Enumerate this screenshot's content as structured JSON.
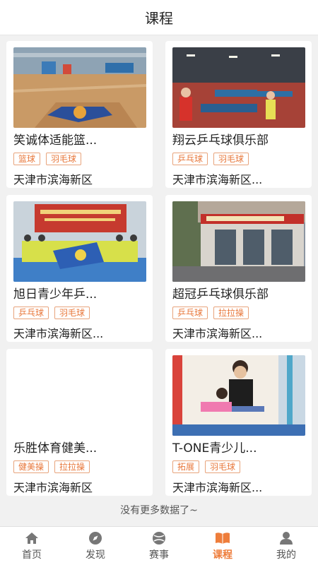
{
  "header": {
    "title": "课程"
  },
  "courses": [
    {
      "title": "笑诚体适能篮...",
      "tags": [
        "篮球",
        "羽毛球"
      ],
      "location": "天津市滨海新区"
    },
    {
      "title": "翔云乒乓球俱乐部",
      "tags": [
        "乒乓球",
        "羽毛球"
      ],
      "location": "天津市滨海新区..."
    },
    {
      "title": "旭日青少年乒...",
      "tags": [
        "乒乓球",
        "羽毛球"
      ],
      "location": "天津市滨海新区..."
    },
    {
      "title": "超冠乒乓球俱乐部",
      "tags": [
        "乒乓球",
        "拉拉操"
      ],
      "location": "天津市滨海新区..."
    },
    {
      "title": "乐胜体育健美...",
      "tags": [
        "健美操",
        "拉拉操"
      ],
      "location": "天津市滨海新区"
    },
    {
      "title": "T-ONE青少儿...",
      "tags": [
        "拓展",
        "羽毛球"
      ],
      "location": "天津市滨海新区..."
    }
  ],
  "footer_note": "没有更多数据了~",
  "tabbar": {
    "items": [
      {
        "label": "首页",
        "icon": "home-icon"
      },
      {
        "label": "发现",
        "icon": "compass-icon"
      },
      {
        "label": "赛事",
        "icon": "ball-icon"
      },
      {
        "label": "课程",
        "icon": "book-icon"
      },
      {
        "label": "我的",
        "icon": "person-icon"
      }
    ],
    "active_index": 3,
    "active_color": "#ee7d3b",
    "inactive_color": "#777777"
  },
  "colors": {
    "tag_text": "#e8773a",
    "tag_border": "#e8a47c",
    "background": "#f1f1f1"
  }
}
